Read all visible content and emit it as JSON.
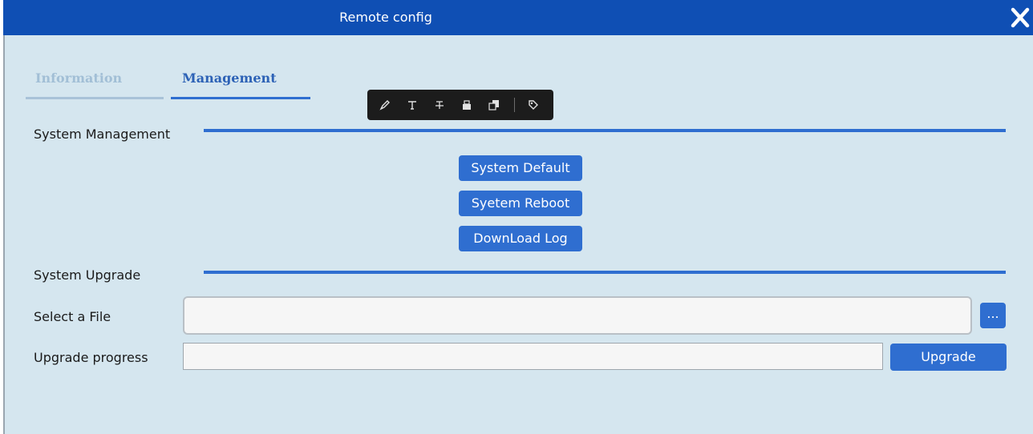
{
  "window": {
    "title": "Remote config"
  },
  "tabs": [
    {
      "label": "Information",
      "active": false
    },
    {
      "label": "Management",
      "active": true
    }
  ],
  "system_management": {
    "heading": "System Management",
    "buttons": [
      "System Default",
      "Syetem Reboot",
      "DownLoad Log"
    ]
  },
  "system_upgrade": {
    "heading": "System Upgrade",
    "select_file_label": "Select a File",
    "file_value": "",
    "browse_label": "...",
    "progress_label": "Upgrade progress",
    "progress_value": 0,
    "upgrade_button": "Upgrade"
  },
  "toolbar_icons": [
    "highlighter-icon",
    "text-icon",
    "strikethrough-icon",
    "stamp-icon",
    "copy-icon",
    "tag-icon"
  ],
  "colors": {
    "titlebar": "#0f4fb4",
    "accent": "#2f6ed0",
    "panel": "#d5e6ef",
    "inactive_tab": "#a2bfd6"
  }
}
